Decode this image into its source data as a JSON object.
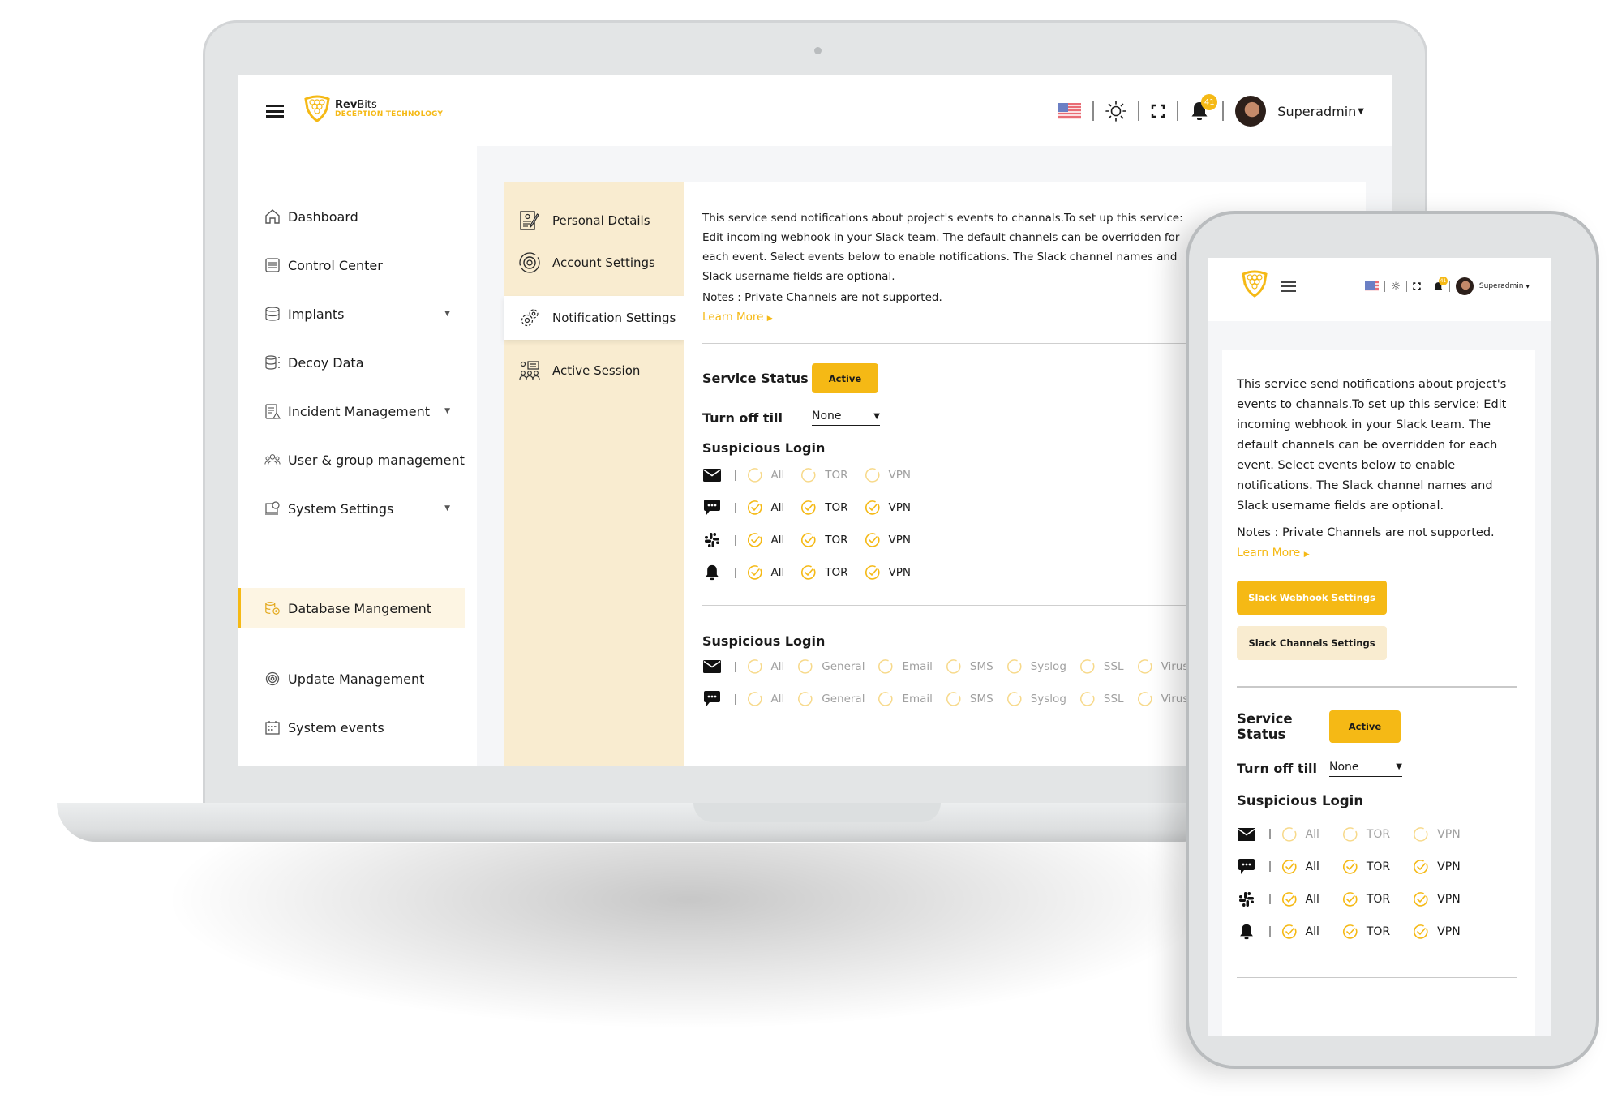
{
  "app": {
    "brand_name_bold": "Rev",
    "brand_name_light": "Bits",
    "brand_tagline": "DECEPTION TECHNOLOGY",
    "accent_color": "#f5b915",
    "accent_light": "#f9ecd0"
  },
  "header": {
    "language_flag": "us-flag-icon",
    "theme_icon": "sun-icon",
    "fullscreen_icon": "expand-icon",
    "notification_count": "41",
    "user_name": "Superadmin"
  },
  "sidebar": {
    "items": [
      {
        "label": "Dashboard",
        "icon": "home-icon",
        "has_dropdown": false
      },
      {
        "label": "Control Center",
        "icon": "sliders-icon",
        "has_dropdown": false
      },
      {
        "label": "Implants",
        "icon": "database-icon",
        "has_dropdown": true
      },
      {
        "label": "Decoy Data",
        "icon": "decoy-data-icon",
        "has_dropdown": false
      },
      {
        "label": "Incident Management",
        "icon": "clipboard-alert-icon",
        "has_dropdown": true
      },
      {
        "label": "User & group management",
        "icon": "users-icon",
        "has_dropdown": false
      },
      {
        "label": "System Settings",
        "icon": "system-settings-icon",
        "has_dropdown": true
      },
      {
        "label": "Database Mangement",
        "icon": "database-gear-icon",
        "has_dropdown": false,
        "active": true
      },
      {
        "label": "Update Management",
        "icon": "update-icon",
        "has_dropdown": false
      },
      {
        "label": "System events",
        "icon": "calendar-icon",
        "has_dropdown": false
      }
    ]
  },
  "profile_tabs": [
    {
      "label": "Personal Details",
      "icon": "personal-details-icon"
    },
    {
      "label": "Account Settings",
      "icon": "account-settings-icon"
    },
    {
      "label": "Notification Settings",
      "icon": "notification-settings-icon",
      "active": true
    },
    {
      "label": "Active Session",
      "icon": "active-session-icon"
    }
  ],
  "notification": {
    "description": "This service send notifications about project's events to channals.To set up this service: Edit incoming webhook in your Slack team. The default channels can be overridden for each event. Select events below to enable notifications. The Slack channel names and Slack username fields are optional.",
    "notes": "Notes : Private Channels are not supported.",
    "learn_more": "Learn More",
    "service_status_label": "Service Status",
    "service_status_value": "Active",
    "turn_off_label": "Turn off till",
    "turn_off_value": "None",
    "slack_webhook_button": "Slack Webhook Settings",
    "slack_channels_button": "Slack Channels Settings",
    "section1": {
      "title": "Suspicious Login",
      "options": [
        "All",
        "TOR",
        "VPN"
      ],
      "rows": [
        {
          "channel": "email",
          "icon": "envelope-icon",
          "checked": [
            false,
            false,
            false
          ]
        },
        {
          "channel": "chat",
          "icon": "chat-icon",
          "checked": [
            true,
            true,
            true
          ]
        },
        {
          "channel": "slack",
          "icon": "slack-icon",
          "checked": [
            true,
            true,
            true
          ]
        },
        {
          "channel": "push",
          "icon": "bell-icon",
          "checked": [
            true,
            true,
            true
          ]
        }
      ]
    },
    "section2": {
      "title": "Suspicious Login",
      "options": [
        "All",
        "General",
        "Email",
        "SMS",
        "Syslog",
        "SSL",
        "Virus Total"
      ],
      "rows": [
        {
          "channel": "email",
          "icon": "envelope-icon",
          "checked": [
            false,
            false,
            false,
            false,
            false,
            false,
            false
          ]
        },
        {
          "channel": "chat",
          "icon": "chat-icon",
          "checked": [
            false,
            false,
            false,
            false,
            false,
            false,
            false
          ]
        }
      ]
    }
  }
}
